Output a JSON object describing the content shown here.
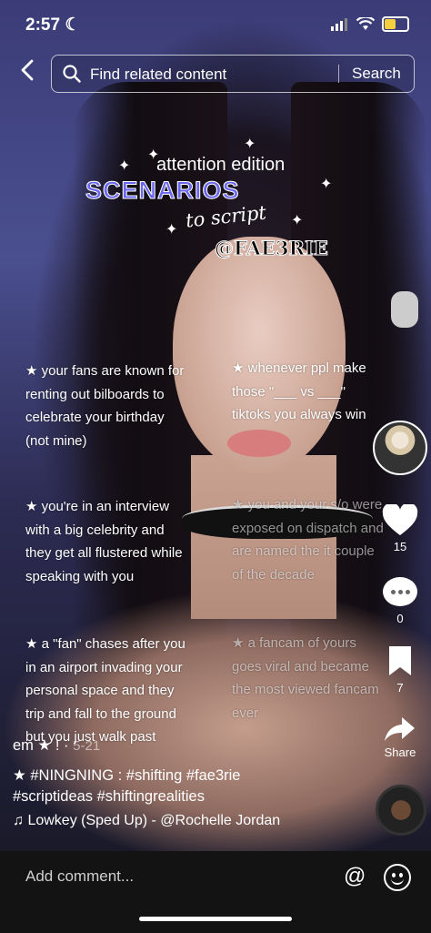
{
  "status_bar": {
    "time": "2:57"
  },
  "search": {
    "placeholder": "Find related content",
    "button_label": "Search"
  },
  "overlay": {
    "line1": "attention edition",
    "title": "SCENARIOS",
    "subtitle": "to script",
    "handle": "@FAE3RIE"
  },
  "scenarios": [
    "★ your fans are known for renting out bilboards to celebrate your birthday (not mine)",
    "★ you're in an interview with a big celebrity and they get all flustered while speaking with you",
    "★ a \"fan\" chases after you in an airport invading your personal space and they trip and fall to the ground but you just walk past",
    "★ whenever ppl make those \"___ vs ___\" tiktoks you always win",
    "★ you and your s/o were exposed on dispatch and are named the it couple of the decade",
    "★ a fancam of yours goes viral and became the most viewed fancam ever"
  ],
  "actions": {
    "likes": "15",
    "comments": "0",
    "saves": "7",
    "share_label": "Share"
  },
  "caption": {
    "user_line": "em ★ !",
    "date": "5-21",
    "text_line1": "★ #NINGNING : #shifting #fae3rie",
    "text_line2": "#scriptideas #shiftingrealities"
  },
  "music": {
    "label": "♫ Lowkey (Sped Up) - @Rochelle Jordan"
  },
  "comment_bar": {
    "placeholder": "Add comment...",
    "mention_symbol": "@"
  }
}
